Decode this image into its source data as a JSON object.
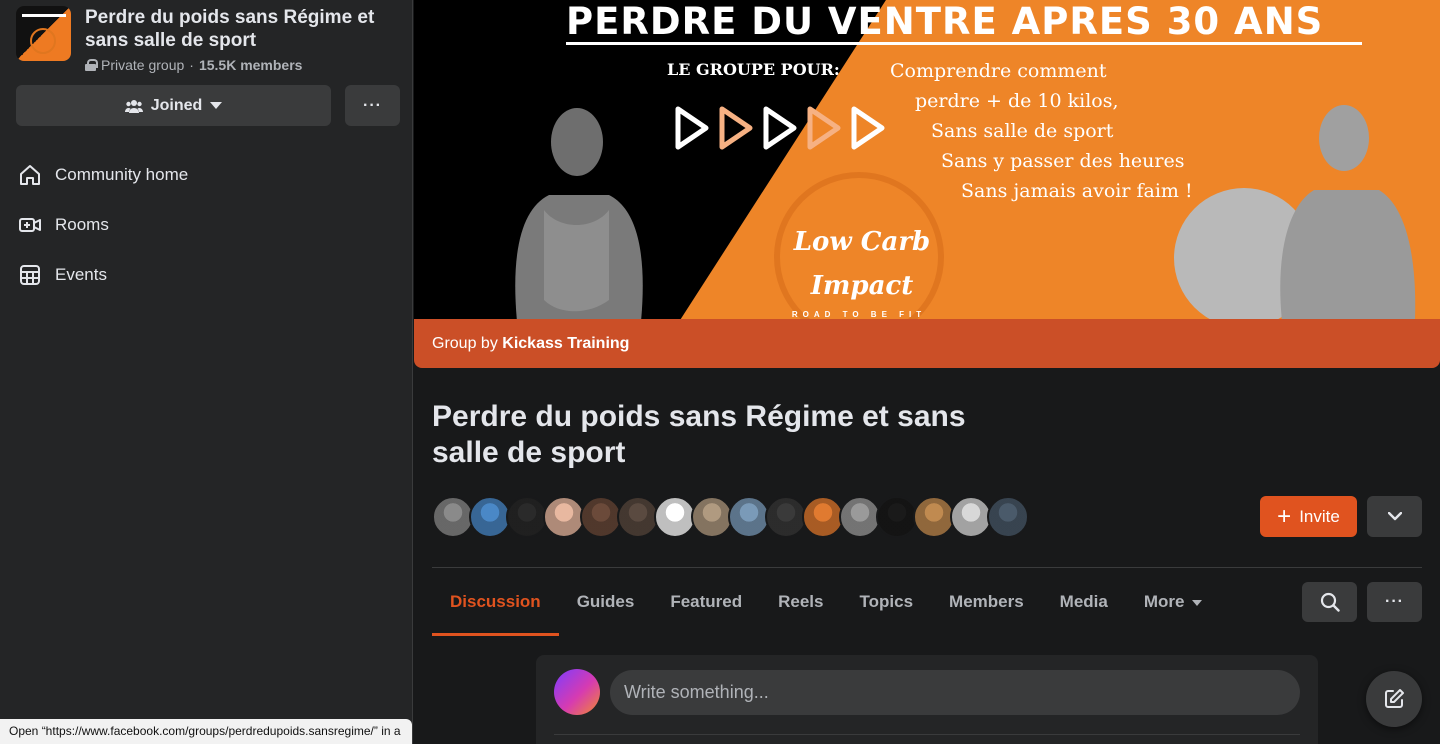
{
  "sidebar": {
    "group_name": "Perdre du poids sans Régime et sans salle de sport",
    "privacy": "Private group",
    "separator": "·",
    "members": "15.5K members",
    "joined_label": "Joined",
    "more_label": "···",
    "nav": [
      {
        "label": "Community home",
        "icon": "home-icon"
      },
      {
        "label": "Rooms",
        "icon": "video-plus-icon"
      },
      {
        "label": "Events",
        "icon": "calendar-icon"
      }
    ]
  },
  "cover": {
    "title": "PERDRE DU VENTRE APRES 30 ANS",
    "lead": "LE GROUPE POUR:",
    "list": [
      "Comprendre comment",
      "perdre + de 10 kilos,",
      "Sans salle de sport",
      "Sans y passer des heures",
      "Sans jamais avoir faim !"
    ],
    "logo_line1": "Low Carb",
    "logo_line2": "Impact",
    "logo_sub": "ROAD TO BE FIT"
  },
  "group_by": {
    "prefix": "Group by",
    "owner": "Kickass Training"
  },
  "main": {
    "title": "Perdre du poids sans Régime et sans salle de sport",
    "invite_label": "Invite",
    "tabs": [
      {
        "label": "Discussion",
        "active": true
      },
      {
        "label": "Guides"
      },
      {
        "label": "Featured"
      },
      {
        "label": "Reels"
      },
      {
        "label": "Topics"
      },
      {
        "label": "Members"
      },
      {
        "label": "Media"
      },
      {
        "label": "More"
      }
    ],
    "more_label": "···",
    "composer_placeholder": "Write something..."
  },
  "avatars": [
    "#8a8a8a",
    "#4a88c7",
    "#2a2a2a",
    "#e8b8a0",
    "#6b4a3a",
    "#5a4a40",
    "#ffffff",
    "#b09a80",
    "#7a9ab8",
    "#3a3a3a",
    "#e07a30",
    "#9a9a9a",
    "#1a1a1a",
    "#c08a50",
    "#d8d8d8",
    "#4a5a6a"
  ],
  "status_bar": {
    "text": "Open “https://www.facebook.com/groups/perdredupoids.sansregime/” in a new tab"
  },
  "colors": {
    "accent": "#e0531f",
    "group_by_bar": "#cb4f27",
    "surface": "#242526",
    "background": "#18191a"
  }
}
